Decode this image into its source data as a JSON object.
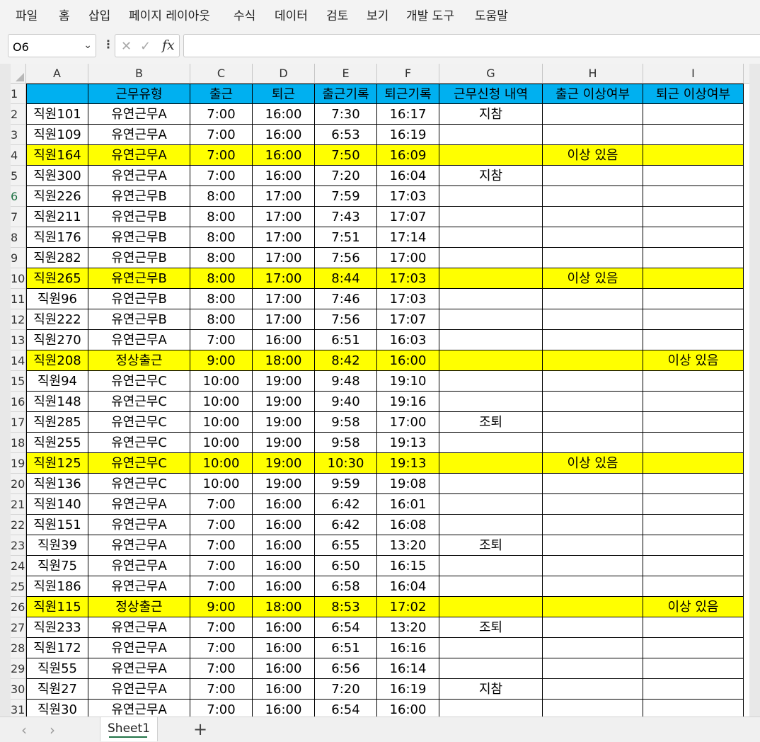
{
  "menu": [
    "파일",
    "홈",
    "삽입",
    "페이지 레이아웃",
    "수식",
    "데이터",
    "검토",
    "보기",
    "개발 도구",
    "도움말"
  ],
  "formula_bar": {
    "cell_ref": "O6",
    "formula": "",
    "cancel_icon": "✕",
    "enter_icon": "✓",
    "fx_label": "fx"
  },
  "columns": [
    "A",
    "B",
    "C",
    "D",
    "E",
    "F",
    "G",
    "H",
    "I"
  ],
  "header_row": [
    "",
    "근무유형",
    "출근",
    "퇴근",
    "출근기록",
    "퇴근기록",
    "근무신청 내역",
    "출근 이상여부",
    "퇴근 이상여부"
  ],
  "rows": [
    {
      "num": "2",
      "cells": [
        "직원101",
        "유연근무A",
        "7:00",
        "16:00",
        "7:30",
        "16:17",
        "지참",
        "",
        ""
      ],
      "highlight": false
    },
    {
      "num": "3",
      "cells": [
        "직원109",
        "유연근무A",
        "7:00",
        "16:00",
        "6:53",
        "16:19",
        "",
        "",
        ""
      ],
      "highlight": false
    },
    {
      "num": "4",
      "cells": [
        "직원164",
        "유연근무A",
        "7:00",
        "16:00",
        "7:50",
        "16:09",
        "",
        "이상 있음",
        ""
      ],
      "highlight": true
    },
    {
      "num": "5",
      "cells": [
        "직원300",
        "유연근무A",
        "7:00",
        "16:00",
        "7:20",
        "16:04",
        "지참",
        "",
        ""
      ],
      "highlight": false
    },
    {
      "num": "6",
      "cells": [
        "직원226",
        "유연근무B",
        "8:00",
        "17:00",
        "7:59",
        "17:03",
        "",
        "",
        ""
      ],
      "highlight": false
    },
    {
      "num": "7",
      "cells": [
        "직원211",
        "유연근무B",
        "8:00",
        "17:00",
        "7:43",
        "17:07",
        "",
        "",
        ""
      ],
      "highlight": false
    },
    {
      "num": "8",
      "cells": [
        "직원176",
        "유연근무B",
        "8:00",
        "17:00",
        "7:51",
        "17:14",
        "",
        "",
        ""
      ],
      "highlight": false
    },
    {
      "num": "9",
      "cells": [
        "직원282",
        "유연근무B",
        "8:00",
        "17:00",
        "7:56",
        "17:00",
        "",
        "",
        ""
      ],
      "highlight": false
    },
    {
      "num": "10",
      "cells": [
        "직원265",
        "유연근무B",
        "8:00",
        "17:00",
        "8:44",
        "17:03",
        "",
        "이상 있음",
        ""
      ],
      "highlight": true
    },
    {
      "num": "11",
      "cells": [
        "직원96",
        "유연근무B",
        "8:00",
        "17:00",
        "7:46",
        "17:03",
        "",
        "",
        ""
      ],
      "highlight": false
    },
    {
      "num": "12",
      "cells": [
        "직원222",
        "유연근무B",
        "8:00",
        "17:00",
        "7:56",
        "17:07",
        "",
        "",
        ""
      ],
      "highlight": false
    },
    {
      "num": "13",
      "cells": [
        "직원270",
        "유연근무A",
        "7:00",
        "16:00",
        "6:51",
        "16:03",
        "",
        "",
        ""
      ],
      "highlight": false
    },
    {
      "num": "14",
      "cells": [
        "직원208",
        "정상출근",
        "9:00",
        "18:00",
        "8:42",
        "16:00",
        "",
        "",
        "이상 있음"
      ],
      "highlight": true
    },
    {
      "num": "15",
      "cells": [
        "직원94",
        "유연근무C",
        "10:00",
        "19:00",
        "9:48",
        "19:10",
        "",
        "",
        ""
      ],
      "highlight": false
    },
    {
      "num": "16",
      "cells": [
        "직원148",
        "유연근무C",
        "10:00",
        "19:00",
        "9:40",
        "19:16",
        "",
        "",
        ""
      ],
      "highlight": false
    },
    {
      "num": "17",
      "cells": [
        "직원285",
        "유연근무C",
        "10:00",
        "19:00",
        "9:58",
        "17:00",
        "조퇴",
        "",
        ""
      ],
      "highlight": false
    },
    {
      "num": "18",
      "cells": [
        "직원255",
        "유연근무C",
        "10:00",
        "19:00",
        "9:58",
        "19:13",
        "",
        "",
        ""
      ],
      "highlight": false
    },
    {
      "num": "19",
      "cells": [
        "직원125",
        "유연근무C",
        "10:00",
        "19:00",
        "10:30",
        "19:13",
        "",
        "이상 있음",
        ""
      ],
      "highlight": true
    },
    {
      "num": "20",
      "cells": [
        "직원136",
        "유연근무C",
        "10:00",
        "19:00",
        "9:59",
        "19:08",
        "",
        "",
        ""
      ],
      "highlight": false
    },
    {
      "num": "21",
      "cells": [
        "직원140",
        "유연근무A",
        "7:00",
        "16:00",
        "6:42",
        "16:01",
        "",
        "",
        ""
      ],
      "highlight": false
    },
    {
      "num": "22",
      "cells": [
        "직원151",
        "유연근무A",
        "7:00",
        "16:00",
        "6:42",
        "16:08",
        "",
        "",
        ""
      ],
      "highlight": false
    },
    {
      "num": "23",
      "cells": [
        "직원39",
        "유연근무A",
        "7:00",
        "16:00",
        "6:55",
        "13:20",
        "조퇴",
        "",
        ""
      ],
      "highlight": false
    },
    {
      "num": "24",
      "cells": [
        "직원75",
        "유연근무A",
        "7:00",
        "16:00",
        "6:50",
        "16:15",
        "",
        "",
        ""
      ],
      "highlight": false
    },
    {
      "num": "25",
      "cells": [
        "직원186",
        "유연근무A",
        "7:00",
        "16:00",
        "6:58",
        "16:04",
        "",
        "",
        ""
      ],
      "highlight": false
    },
    {
      "num": "26",
      "cells": [
        "직원115",
        "정상출근",
        "9:00",
        "18:00",
        "8:53",
        "17:02",
        "",
        "",
        "이상 있음"
      ],
      "highlight": true
    },
    {
      "num": "27",
      "cells": [
        "직원233",
        "유연근무A",
        "7:00",
        "16:00",
        "6:54",
        "13:20",
        "조퇴",
        "",
        ""
      ],
      "highlight": false
    },
    {
      "num": "28",
      "cells": [
        "직원172",
        "유연근무A",
        "7:00",
        "16:00",
        "6:51",
        "16:16",
        "",
        "",
        ""
      ],
      "highlight": false
    },
    {
      "num": "29",
      "cells": [
        "직원55",
        "유연근무A",
        "7:00",
        "16:00",
        "6:56",
        "16:14",
        "",
        "",
        ""
      ],
      "highlight": false
    },
    {
      "num": "30",
      "cells": [
        "직원27",
        "유연근무A",
        "7:00",
        "16:00",
        "7:20",
        "16:19",
        "지참",
        "",
        ""
      ],
      "highlight": false
    },
    {
      "num": "31",
      "cells": [
        "직원30",
        "유연근무A",
        "7:00",
        "16:00",
        "6:54",
        "16:00",
        "",
        "",
        ""
      ],
      "highlight": false
    }
  ],
  "active_row": "6",
  "colors": {
    "header_fill": "#00b0f0",
    "highlight_fill": "#ffff00",
    "accent": "#217346"
  },
  "sheet_tabs": [
    "Sheet1"
  ],
  "tab_nav": {
    "prev": "‹",
    "next": "›",
    "add": "+"
  }
}
